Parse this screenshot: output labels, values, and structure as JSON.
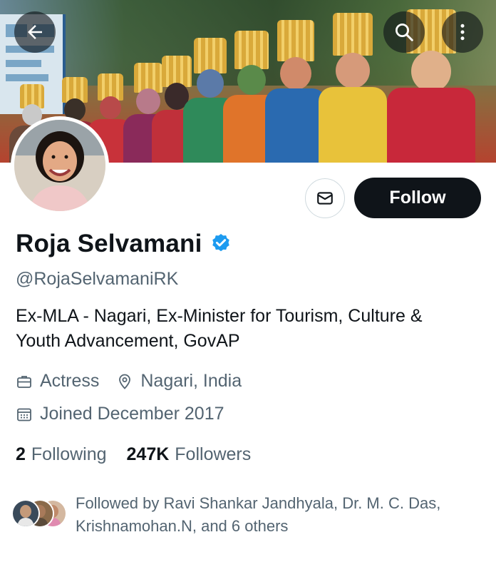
{
  "header": {
    "back_icon": "arrow-left-icon",
    "search_icon": "search-icon",
    "more_icon": "more-vertical-icon"
  },
  "profile": {
    "name": "Roja Selvamani",
    "verified": true,
    "handle": "@RojaSelvamaniRK",
    "bio": "Ex-MLA - Nagari, Ex-Minister for Tourism, Culture & Youth Advancement, GovAP",
    "profession": "Actress",
    "location": "Nagari, India",
    "joined": "Joined December 2017"
  },
  "actions": {
    "message_icon": "mail-icon",
    "follow_label": "Follow"
  },
  "stats": {
    "following_count": "2",
    "following_label": "Following",
    "followers_count": "247K",
    "followers_label": "Followers"
  },
  "followed_by": {
    "text": "Followed by Ravi Shankar Jandhyala, Dr. M. C. Das, Krishnamohan.N, and 6 others"
  },
  "colors": {
    "follow_button_bg": "#0f1419",
    "secondary_text": "#536471",
    "verified_blue": "#1d9bf0"
  }
}
